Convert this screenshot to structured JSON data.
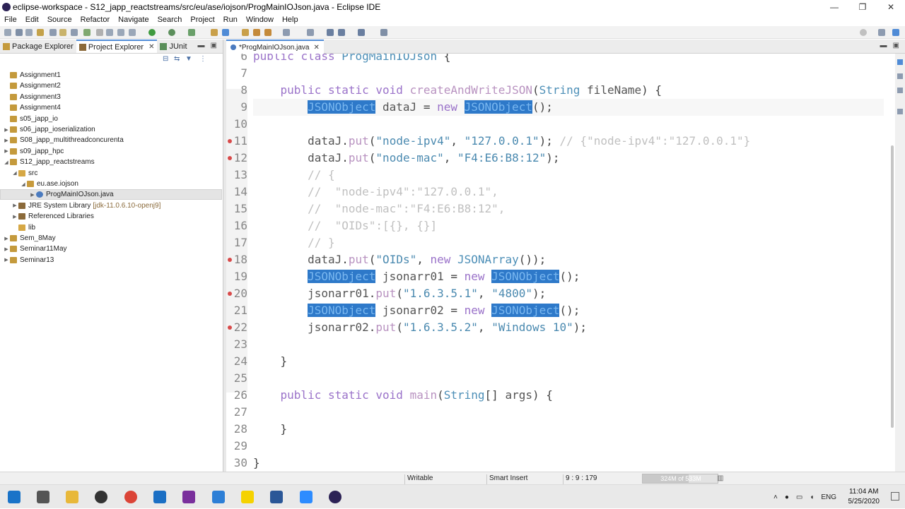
{
  "window": {
    "title": "eclipse-workspace - S12_japp_reactstreams/src/eu/ase/iojson/ProgMainIOJson.java - Eclipse IDE",
    "controls": [
      "—",
      "❐",
      "✕"
    ]
  },
  "menu": [
    "File",
    "Edit",
    "Source",
    "Refactor",
    "Navigate",
    "Search",
    "Project",
    "Run",
    "Window",
    "Help"
  ],
  "left_panel": {
    "tabs": [
      {
        "label": "Package Explorer",
        "active": false
      },
      {
        "label": "Project Explorer",
        "active": true,
        "close": "✕"
      },
      {
        "label": "JUnit",
        "active": false
      }
    ],
    "tree": [
      {
        "label": "Assignment1",
        "level": 1,
        "icon": "project-icon",
        "arrow": ""
      },
      {
        "label": "Assignment2",
        "level": 1,
        "icon": "project-icon",
        "arrow": ""
      },
      {
        "label": "Assignment3",
        "level": 1,
        "icon": "project-icon",
        "arrow": ""
      },
      {
        "label": "Assignment4",
        "level": 1,
        "icon": "project-icon",
        "arrow": ""
      },
      {
        "label": "s05_japp_io",
        "level": 1,
        "icon": "project-icon",
        "arrow": ""
      },
      {
        "label": "s06_japp_ioserialization",
        "level": 1,
        "icon": "project-icon",
        "arrow": "▶"
      },
      {
        "label": "S08_japp_multithreadconcurenta",
        "level": 1,
        "icon": "project-icon",
        "arrow": "▶"
      },
      {
        "label": "s09_japp_hpc",
        "level": 1,
        "icon": "project-icon",
        "arrow": "▶"
      },
      {
        "label": "S12_japp_reactstreams",
        "level": 1,
        "icon": "project-icon",
        "arrow": "◢"
      },
      {
        "label": "src",
        "level": 2,
        "icon": "src-icon",
        "arrow": "◢"
      },
      {
        "label": "eu.ase.iojson",
        "level": 3,
        "icon": "package-icon",
        "arrow": "◢"
      },
      {
        "label": "ProgMainIOJson.java",
        "level": 4,
        "icon": "java-file-icon",
        "arrow": "▶",
        "selected": true
      },
      {
        "label": "JRE System Library",
        "suffix": "[jdk-11.0.6.10-openj9]",
        "level": 2,
        "icon": "library-icon",
        "arrow": "▶"
      },
      {
        "label": "Referenced Libraries",
        "level": 2,
        "icon": "library-icon",
        "arrow": "▶"
      },
      {
        "label": "lib",
        "level": 2,
        "icon": "folder-icon",
        "arrow": ""
      },
      {
        "label": "Sem_8May",
        "level": 1,
        "icon": "project-icon",
        "arrow": "▶"
      },
      {
        "label": "Seminar11May",
        "level": 1,
        "icon": "project-icon",
        "arrow": "▶"
      },
      {
        "label": "Seminar13",
        "level": 1,
        "icon": "project-icon",
        "arrow": "▶"
      }
    ]
  },
  "editor": {
    "tab": {
      "label": "*ProgMainIOJson.java",
      "close": "✕"
    },
    "lines": [
      {
        "n": "6",
        "tokens": [
          [
            "kw",
            "public "
          ],
          [
            "kw",
            "class "
          ],
          [
            "cls",
            "ProgMainIOJson "
          ],
          [
            "plain",
            "{"
          ]
        ]
      },
      {
        "n": "7",
        "tokens": []
      },
      {
        "n": "8",
        "tokens": [
          [
            "plain",
            "    "
          ],
          [
            "kw",
            "public "
          ],
          [
            "kw",
            "static "
          ],
          [
            "kw",
            "void "
          ],
          [
            "fn",
            "createAndWriteJSON"
          ],
          [
            "plain",
            "("
          ],
          [
            "cls",
            "String "
          ],
          [
            "var",
            "fileName"
          ],
          [
            "plain",
            ") {"
          ]
        ]
      },
      {
        "n": "9",
        "tokens": [
          [
            "plain",
            "        "
          ],
          [
            "hl",
            "JSONObject"
          ],
          [
            "var",
            " dataJ "
          ],
          [
            "plain",
            "= "
          ],
          [
            "kw",
            "new "
          ],
          [
            "hl",
            "JSONObject"
          ],
          [
            "plain",
            "();"
          ]
        ]
      },
      {
        "n": "10",
        "tokens": []
      },
      {
        "n": "11",
        "tokens": [
          [
            "plain",
            "        "
          ],
          [
            "var",
            "dataJ"
          ],
          [
            "plain",
            "."
          ],
          [
            "fn",
            "put"
          ],
          [
            "plain",
            "("
          ],
          [
            "str",
            "\"node-ipv4\""
          ],
          [
            "plain",
            ", "
          ],
          [
            "str",
            "\"127.0.0.1\""
          ],
          [
            "plain",
            "); "
          ],
          [
            "cm",
            "// {\"node-ipv4\":\"127.0.0.1\"}"
          ]
        ]
      },
      {
        "n": "12",
        "tokens": [
          [
            "plain",
            "        "
          ],
          [
            "var",
            "dataJ"
          ],
          [
            "plain",
            "."
          ],
          [
            "fn",
            "put"
          ],
          [
            "plain",
            "("
          ],
          [
            "str",
            "\"node-mac\""
          ],
          [
            "plain",
            ", "
          ],
          [
            "str",
            "\"F4:E6:B8:12\""
          ],
          [
            "plain",
            ");"
          ]
        ]
      },
      {
        "n": "13",
        "tokens": [
          [
            "plain",
            "        "
          ],
          [
            "cm",
            "// {"
          ]
        ]
      },
      {
        "n": "14",
        "tokens": [
          [
            "plain",
            "        "
          ],
          [
            "cm",
            "//  \"node-ipv4\":\"127.0.0.1\","
          ]
        ]
      },
      {
        "n": "15",
        "tokens": [
          [
            "plain",
            "        "
          ],
          [
            "cm",
            "//  \"node-mac\":\"F4:E6:B8:12\","
          ]
        ]
      },
      {
        "n": "16",
        "tokens": [
          [
            "plain",
            "        "
          ],
          [
            "cm",
            "//  \"OIDs\":[{}, {}]"
          ]
        ]
      },
      {
        "n": "17",
        "tokens": [
          [
            "plain",
            "        "
          ],
          [
            "cm",
            "// }"
          ]
        ]
      },
      {
        "n": "18",
        "tokens": [
          [
            "plain",
            "        "
          ],
          [
            "var",
            "dataJ"
          ],
          [
            "plain",
            "."
          ],
          [
            "fn",
            "put"
          ],
          [
            "plain",
            "("
          ],
          [
            "str",
            "\"OIDs\""
          ],
          [
            "plain",
            ", "
          ],
          [
            "kw",
            "new "
          ],
          [
            "cls",
            "JSONArray"
          ],
          [
            "plain",
            "());"
          ]
        ]
      },
      {
        "n": "19",
        "tokens": [
          [
            "plain",
            "        "
          ],
          [
            "hl",
            "JSONObject"
          ],
          [
            "var",
            " jsonarr01 "
          ],
          [
            "plain",
            "= "
          ],
          [
            "kw",
            "new "
          ],
          [
            "hl",
            "JSONObject"
          ],
          [
            "plain",
            "();"
          ]
        ]
      },
      {
        "n": "20",
        "tokens": [
          [
            "plain",
            "        "
          ],
          [
            "var",
            "jsonarr01"
          ],
          [
            "plain",
            "."
          ],
          [
            "fn",
            "put"
          ],
          [
            "plain",
            "("
          ],
          [
            "str",
            "\"1.6.3.5.1\""
          ],
          [
            "plain",
            ", "
          ],
          [
            "str",
            "\"4800\""
          ],
          [
            "plain",
            ");"
          ]
        ]
      },
      {
        "n": "21",
        "tokens": [
          [
            "plain",
            "        "
          ],
          [
            "hl",
            "JSONObject"
          ],
          [
            "var",
            " jsonarr02 "
          ],
          [
            "plain",
            "= "
          ],
          [
            "kw",
            "new "
          ],
          [
            "hl",
            "JSONObject"
          ],
          [
            "plain",
            "();"
          ]
        ]
      },
      {
        "n": "22",
        "tokens": [
          [
            "plain",
            "        "
          ],
          [
            "var",
            "jsonarr02"
          ],
          [
            "plain",
            "."
          ],
          [
            "fn",
            "put"
          ],
          [
            "plain",
            "("
          ],
          [
            "str",
            "\"1.6.3.5.2\""
          ],
          [
            "plain",
            ", "
          ],
          [
            "str",
            "\"Windows 10\""
          ],
          [
            "plain",
            ");"
          ]
        ]
      },
      {
        "n": "23",
        "tokens": []
      },
      {
        "n": "24",
        "tokens": [
          [
            "plain",
            "    }"
          ]
        ]
      },
      {
        "n": "25",
        "tokens": []
      },
      {
        "n": "26",
        "tokens": [
          [
            "plain",
            "    "
          ],
          [
            "kw",
            "public "
          ],
          [
            "kw",
            "static "
          ],
          [
            "kw",
            "void "
          ],
          [
            "fn",
            "main"
          ],
          [
            "plain",
            "("
          ],
          [
            "cls",
            "String"
          ],
          [
            "plain",
            "[] "
          ],
          [
            "var",
            "args"
          ],
          [
            "plain",
            ") {"
          ]
        ]
      },
      {
        "n": "27",
        "tokens": []
      },
      {
        "n": "28",
        "tokens": [
          [
            "plain",
            "    }"
          ]
        ]
      },
      {
        "n": "29",
        "tokens": []
      },
      {
        "n": "30",
        "tokens": [
          [
            "plain",
            "}"
          ]
        ]
      }
    ]
  },
  "status": {
    "mode": "Writable",
    "insert": "Smart Insert",
    "position": "9 : 9 : 179",
    "heap": "324M of 533M",
    "heap_used_fraction": 0.61
  },
  "taskbar": {
    "tray": [
      "ENG"
    ],
    "time": "11:04 AM",
    "date": "5/25/2020"
  }
}
